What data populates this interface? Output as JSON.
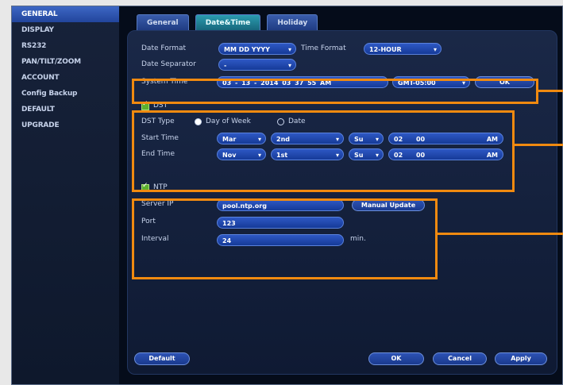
{
  "sidebar": {
    "items": [
      {
        "label": "GENERAL",
        "active": true
      },
      {
        "label": "DISPLAY"
      },
      {
        "label": "RS232"
      },
      {
        "label": "PAN/TILT/ZOOM"
      },
      {
        "label": "ACCOUNT"
      },
      {
        "label": "Config Backup"
      },
      {
        "label": "DEFAULT"
      },
      {
        "label": "UPGRADE"
      }
    ]
  },
  "tabs": [
    {
      "label": "General"
    },
    {
      "label": "Date&Time",
      "active": true
    },
    {
      "label": "Holiday"
    }
  ],
  "form": {
    "date_format_label": "Date Format",
    "date_format_value": "MM DD YYYY",
    "time_format_label": "Time Format",
    "time_format_value": "12-HOUR",
    "date_separator_label": "Date Separator",
    "date_separator_value": "-",
    "system_time_label": "System Time",
    "system_time": {
      "month": "03",
      "sep1": "-",
      "day": "13",
      "sep2": "-",
      "year": "2014",
      "hour": "03",
      "minute": "37",
      "second": "55",
      "ampm": "AM"
    },
    "timezone_value": "GMT-05:00",
    "ok_label": "OK"
  },
  "dst": {
    "checkbox_label": "DST",
    "type_label": "DST Type",
    "opt_day_of_week": "Day of Week",
    "opt_date": "Date",
    "start_label": "Start Time",
    "start": {
      "month": "Mar",
      "week": "2nd",
      "day": "Su",
      "hour": "02",
      "minute": "00",
      "ampm": "AM"
    },
    "end_label": "End Time",
    "end": {
      "month": "Nov",
      "week": "1st",
      "day": "Su",
      "hour": "02",
      "minute": "00",
      "ampm": "AM"
    }
  },
  "ntp": {
    "checkbox_label": "NTP",
    "server_label": "Server IP",
    "server_value": "pool.ntp.org",
    "manual_update_label": "Manual Update",
    "port_label": "Port",
    "port_value": "123",
    "interval_label": "Interval",
    "interval_value": "24",
    "interval_unit": "min."
  },
  "footer": {
    "default_label": "Default",
    "ok_label": "OK",
    "cancel_label": "Cancel",
    "apply_label": "Apply"
  },
  "colors": {
    "highlight": "#f08a10",
    "field": "#2e58c4",
    "active_tab": "#2b9cb0",
    "active_sidebar": "#3d67c4"
  }
}
